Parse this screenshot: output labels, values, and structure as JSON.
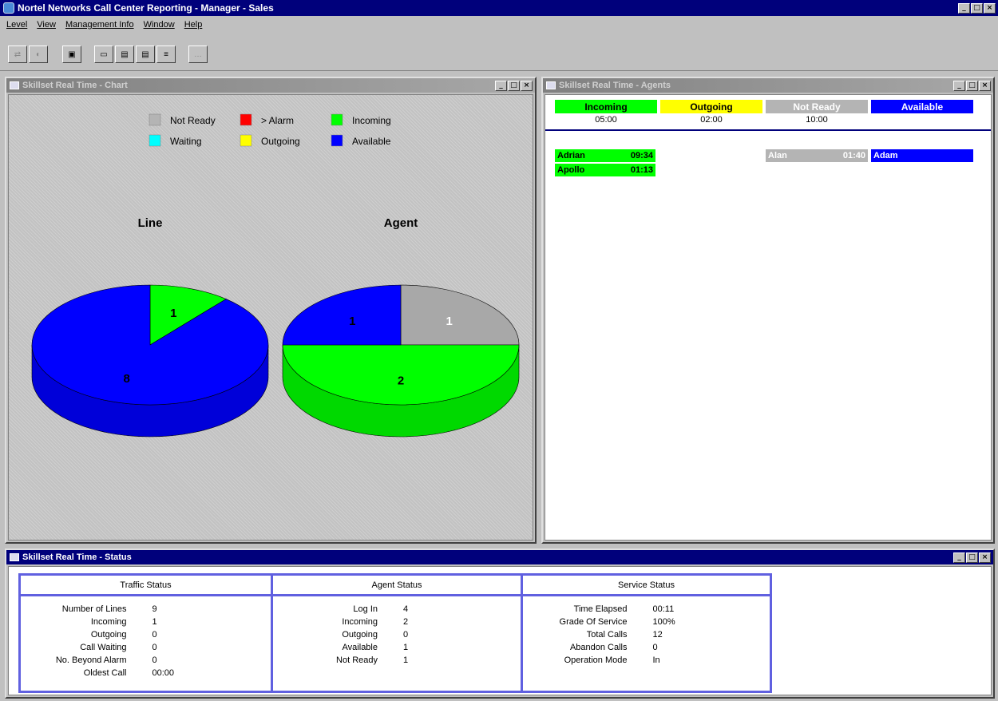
{
  "app": {
    "title": "Nortel Networks Call Center Reporting - Manager - Sales",
    "window_buttons": [
      "_",
      "□",
      "×"
    ]
  },
  "menu": [
    "Level",
    "View",
    "Management Info",
    "Window",
    "Help"
  ],
  "toolbar": {
    "buttons": [
      {
        "glyph": "⇄",
        "enabled": false
      },
      {
        "glyph": "◐",
        "enabled": false
      },
      {
        "glyph": "▣",
        "enabled": true
      },
      {
        "glyph": "▭",
        "enabled": true
      },
      {
        "glyph": "▤",
        "enabled": true
      },
      {
        "glyph": "▤",
        "enabled": true
      },
      {
        "glyph": "≡",
        "enabled": true
      },
      {
        "glyph": "…",
        "enabled": false
      }
    ]
  },
  "chart_window": {
    "title": "Skillset Real Time - Chart",
    "buttons": [
      "_",
      "□",
      "×"
    ],
    "legend": [
      {
        "label": "Not Ready",
        "color": "#b4b4b4"
      },
      {
        "label": "> Alarm",
        "color": "#ff0000"
      },
      {
        "label": "Incoming",
        "color": "#00ff00"
      },
      {
        "label": "Waiting",
        "color": "#00ffff"
      },
      {
        "label": "Outgoing",
        "color": "#ffff00"
      },
      {
        "label": "Available",
        "color": "#0000ff"
      }
    ]
  },
  "chart_data": [
    {
      "type": "pie",
      "title": "Line",
      "slices": [
        {
          "category": "Incoming",
          "value": 1,
          "color": "#00ff00"
        },
        {
          "category": "Available",
          "value": 8,
          "color": "#0000ff"
        }
      ]
    },
    {
      "type": "pie",
      "title": "Agent",
      "slices": [
        {
          "category": "Not Ready",
          "value": 1,
          "color": "#a8a8a8"
        },
        {
          "category": "Incoming",
          "value": 2,
          "color": "#00ff00"
        },
        {
          "category": "Available",
          "value": 1,
          "color": "#0000ff"
        }
      ]
    }
  ],
  "agents_window": {
    "title": "Skillset Real Time - Agents",
    "buttons": [
      "_",
      "□",
      "×"
    ],
    "columns": [
      {
        "label": "Incoming",
        "time": "05:00",
        "bg": "#00ff00",
        "fg": "#000000"
      },
      {
        "label": "Outgoing",
        "time": "02:00",
        "bg": "#ffff00",
        "fg": "#000000"
      },
      {
        "label": "Not Ready",
        "time": "10:00",
        "bg": "#b4b4b4",
        "fg": "#ffffff"
      },
      {
        "label": "Available",
        "time": "",
        "bg": "#0000ff",
        "fg": "#ffffff"
      }
    ],
    "agents": [
      {
        "name": "Adrian",
        "time": "09:34",
        "column": 0,
        "row": 0
      },
      {
        "name": "Apollo",
        "time": "01:13",
        "column": 0,
        "row": 1
      },
      {
        "name": "Alan",
        "time": "01:40",
        "column": 2,
        "row": 0
      },
      {
        "name": "Adam",
        "time": "",
        "column": 3,
        "row": 0
      }
    ]
  },
  "status_window": {
    "title": "Skillset Real Time - Status",
    "buttons": [
      "_",
      "□",
      "×"
    ],
    "panels": [
      {
        "title": "Traffic Status",
        "rows": [
          {
            "label": "Number of Lines",
            "value": "9"
          },
          {
            "label": "Incoming",
            "value": "1"
          },
          {
            "label": "Outgoing",
            "value": "0"
          },
          {
            "label": "Call Waiting",
            "value": "0"
          },
          {
            "label": "No. Beyond Alarm",
            "value": "0"
          },
          {
            "label": "Oldest Call",
            "value": "00:00"
          }
        ]
      },
      {
        "title": "Agent Status",
        "rows": [
          {
            "label": "Log In",
            "value": "4"
          },
          {
            "label": "Incoming",
            "value": "2"
          },
          {
            "label": "Outgoing",
            "value": "0"
          },
          {
            "label": "Available",
            "value": "1"
          },
          {
            "label": "Not Ready",
            "value": "1"
          }
        ]
      },
      {
        "title": "Service Status",
        "rows": [
          {
            "label": "Time Elapsed",
            "value": "00:11"
          },
          {
            "label": "Grade Of Service",
            "value": "100%"
          },
          {
            "label": "Total Calls",
            "value": "12"
          },
          {
            "label": "Abandon Calls",
            "value": "0"
          },
          {
            "label": "Operation Mode",
            "value": "In"
          }
        ]
      }
    ]
  }
}
